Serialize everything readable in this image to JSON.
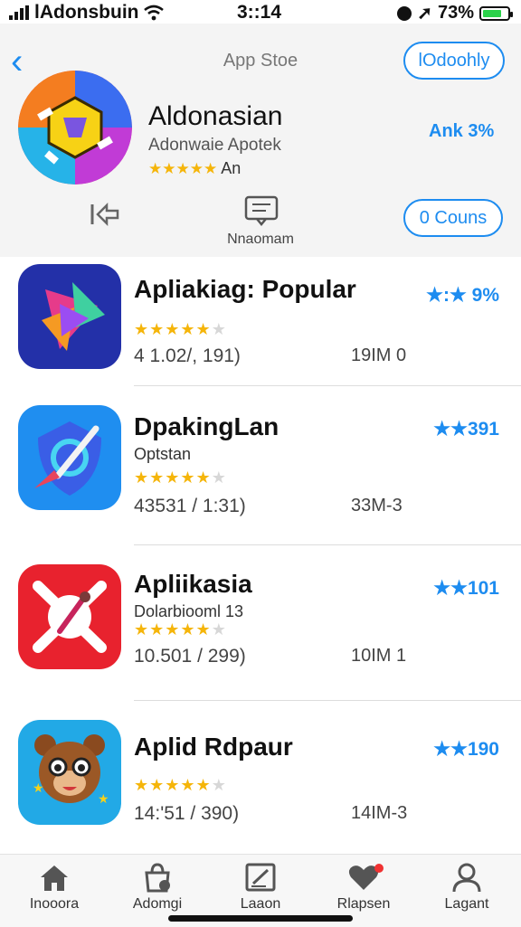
{
  "status_bar": {
    "carrier": "lAdonsbuin",
    "time": "3::14",
    "battery_text": "73%",
    "battery_level": 0.78
  },
  "header": {
    "nav_title": "App Stoe",
    "top_button": "lOdoohly",
    "app_name": "Aldonasian",
    "app_subtitle": "Adonwaie Apotek",
    "app_rating_text": "An",
    "app_rating_stars": "★★★★★",
    "right_metric": "Ank 3%",
    "center_label": "Nnaomam",
    "count_button": "0 Couns"
  },
  "apps": [
    {
      "name": "Apliakiag: Popular",
      "subtitle": "",
      "stars": 4.5,
      "meta": "4 1.02/, 191)",
      "size": "19IM 0",
      "rating": "★:★ 9%",
      "icon": "play-shapes-icon"
    },
    {
      "name": "DpakingLan",
      "subtitle": "Optstan",
      "stars": 4.5,
      "meta": "43531 / 1:31)",
      "size": "33M-3",
      "rating": "★★391",
      "icon": "shield-compass-icon"
    },
    {
      "name": "Apliikasia",
      "subtitle": "Dolarbiooml 13",
      "stars": 4.5,
      "meta": "10.501 / 299)",
      "size": "10IM 1",
      "rating": "★★101",
      "icon": "crossbones-icon"
    },
    {
      "name": "Aplid Rdpaur",
      "subtitle": "",
      "stars": 4.5,
      "meta": "14:'51 / 390)",
      "size": "14IM-3",
      "rating": "★★190",
      "icon": "bear-icon"
    }
  ],
  "tabs": [
    {
      "label": "Inooora",
      "icon": "house-icon"
    },
    {
      "label": "Adomgi",
      "icon": "store-bag-icon"
    },
    {
      "label": "Laaon",
      "icon": "edit-square-icon"
    },
    {
      "label": "Rlapsen",
      "icon": "heart-icon"
    },
    {
      "label": "Lagant",
      "icon": "person-icon"
    }
  ],
  "colors": {
    "accent": "#1d8cf0",
    "star": "#f5b50a",
    "header_bg": "#f4f4f4"
  }
}
